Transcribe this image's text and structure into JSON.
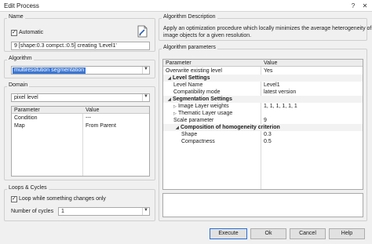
{
  "window": {
    "title": "Edit Process",
    "help_glyph": "?",
    "close_glyph": "✕"
  },
  "name_group": {
    "label": "Name",
    "automatic_label": "Automatic",
    "automatic_checked": true,
    "name_value": "9 [shape:0.3 compct.:0.5] creating 'Level1'"
  },
  "algorithm_group": {
    "label": "Algorithm",
    "selected": "multiresolution segmentation"
  },
  "domain_group": {
    "label": "Domain",
    "selected": "pixel level",
    "columns": [
      "Parameter",
      "Value"
    ],
    "rows": [
      {
        "param": "Condition",
        "value": "---"
      },
      {
        "param": "Map",
        "value": "From Parent"
      }
    ]
  },
  "loops_group": {
    "label": "Loops & Cycles",
    "loop_label": "Loop while something changes only",
    "loop_checked": true,
    "cycles_label": "Number of cycles",
    "cycles_value": "1"
  },
  "algo_description": {
    "label": "Algorithm Description",
    "line1": "Apply an optimization procedure which locally minimizes the average heterogeneity of",
    "line2": "image objects for a given resolution."
  },
  "algo_params": {
    "label": "Algorithm parameters",
    "columns": [
      "Parameter",
      "Value"
    ],
    "rows": [
      {
        "param": "Overwrite existing level",
        "value": "Yes"
      },
      {
        "param": "Level Settings",
        "value": ""
      },
      {
        "param": "Level Name",
        "value": "Level1"
      },
      {
        "param": "Compatibility mode",
        "value": "latest version"
      },
      {
        "param": "Segmentation Settings",
        "value": ""
      },
      {
        "param": "Image Layer weights",
        "value": "1, 1, 1, 1, 1, 1"
      },
      {
        "param": "Thematic Layer usage",
        "value": ""
      },
      {
        "param": "Scale parameter",
        "value": "9"
      },
      {
        "param": "Composition of homogeneity criterion",
        "value": ""
      },
      {
        "param": "Shape",
        "value": "0.3"
      },
      {
        "param": "Compactness",
        "value": "0.5"
      }
    ]
  },
  "buttons": {
    "execute": "Execute",
    "ok": "Ok",
    "cancel": "Cancel",
    "help": "Help"
  },
  "icons": {
    "edit_name": "edit-document-icon",
    "dropdown": "chevron-down-icon",
    "expand": "triangle-icon"
  }
}
